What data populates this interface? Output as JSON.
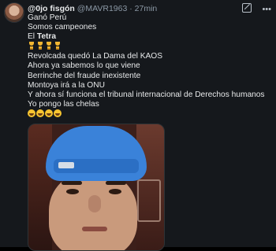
{
  "tweet": {
    "display_name": "@0jo fisgón",
    "handle": "@MAVR1963",
    "separator": "·",
    "time": "27min",
    "more_icon": "more-icon",
    "grok_icon": "grok-icon",
    "lines": {
      "l1": "Ganó Perú",
      "l2": "Somos campeones",
      "l3_prefix": "El ",
      "l3_bold": "Tetra",
      "l5": "Revolcada quedó La Dama del KAOS",
      "l6": "Ahora ya sabemos lo que viene",
      "l7": "Berrinche del fraude inexistente",
      "l8": "Montoya irá a la ONU",
      "l9": "Y ahora sí funciona el tribunal internacional de Derechos humanos",
      "l10": "Yo pongo las chelas"
    },
    "emoji_trophies": [
      "trophy-emoji",
      "trophy-emoji",
      "trophy-emoji",
      "trophy-emoji"
    ],
    "emoji_laughs": [
      "laughing-emoji",
      "laughing-emoji",
      "laughing-emoji",
      "laughing-emoji"
    ]
  },
  "colors": {
    "background": "#15181c",
    "text": "#e7e9ea",
    "muted": "#8b98a5",
    "cap_blue": "#3a82d9"
  }
}
